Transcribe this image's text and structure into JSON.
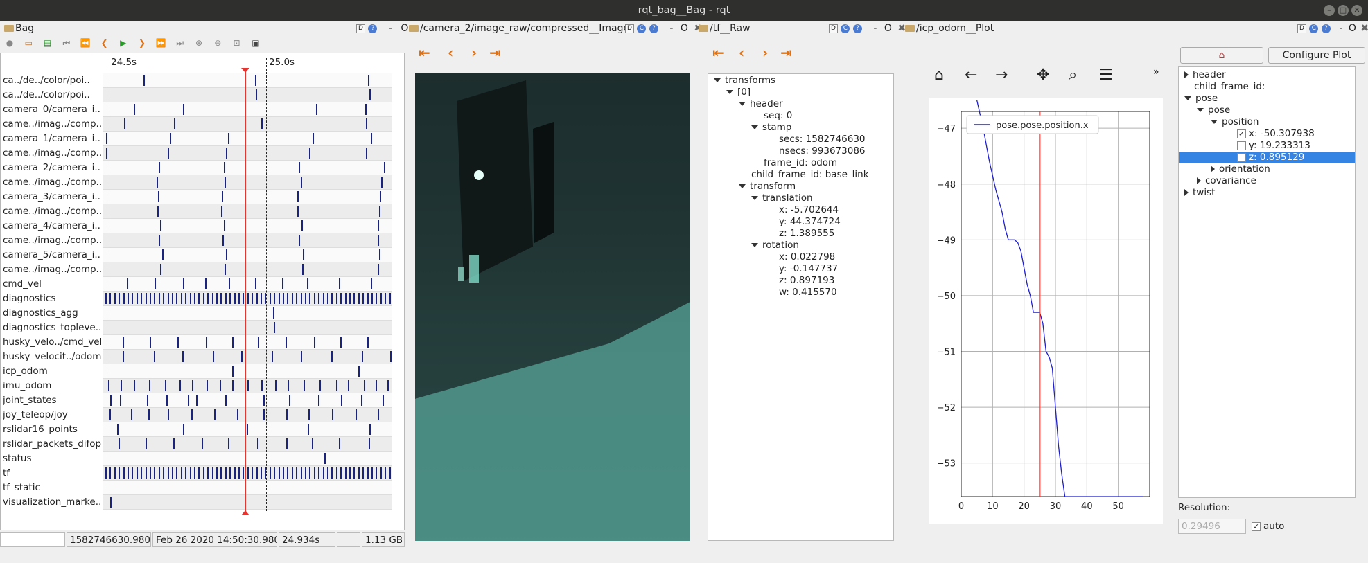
{
  "window": {
    "title": "rqt_bag__Bag - rqt"
  },
  "docks": {
    "bag": {
      "title": "Bag",
      "btns": [
        "D",
        "?",
        "-",
        "O"
      ]
    },
    "image": {
      "title": "/camera_2/image_raw/compressed__Image",
      "btns": [
        "D",
        "C",
        "?",
        "-",
        "O",
        "✖"
      ]
    },
    "tf": {
      "title": "/tf__Raw",
      "btns": [
        "D",
        "C",
        "?",
        "-",
        "O",
        "✖"
      ]
    },
    "plot": {
      "title": "/icp_odom__Plot",
      "btns": [
        "D",
        "C",
        "?",
        "-",
        "O",
        "✖"
      ]
    }
  },
  "bag": {
    "time_ticks": [
      "24.5s",
      "25.0s"
    ],
    "topics": [
      "ca../de../color/poi..",
      "ca../de../color/poi..",
      "camera_0/camera_i..",
      "came../imag../comp..",
      "camera_1/camera_i..",
      "came../imag../comp..",
      "camera_2/camera_i..",
      "came../imag../comp..",
      "camera_3/camera_i..",
      "came../imag../comp..",
      "camera_4/camera_i..",
      "came../imag../comp..",
      "camera_5/camera_i..",
      "came../imag../comp..",
      "cmd_vel",
      "diagnostics",
      "diagnostics_agg",
      "diagnostics_topleve..",
      "husky_velo../cmd_vel",
      "husky_velocit../odom",
      "icp_odom",
      "imu_odom",
      "joint_states",
      "joy_teleop/joy",
      "rslidar16_points",
      "rslidar_packets_difop",
      "status",
      "tf",
      "tf_static",
      "visualization_marke.."
    ],
    "status": {
      "field0": "",
      "stamp": "1582746630.980",
      "date": "Feb 26 2020 14:50:30.980",
      "offset": "24.934s",
      "blank": "",
      "size": "1.13 GB"
    }
  },
  "tf_tree": {
    "transforms": "transforms",
    "index": "[0]",
    "header": "header",
    "seq": "seq:  0",
    "stamp": "stamp",
    "secs": "secs:  1582746630",
    "nsecs": "nsecs:  993673086",
    "frame_id": "frame_id: odom",
    "child_frame_id": "child_frame_id: base_link",
    "transform": "transform",
    "translation": "translation",
    "tx": "x:  -5.702644",
    "ty": "y:  44.374724",
    "tz": "z:  1.389555",
    "rotation": "rotation",
    "rx": "x:  0.022798",
    "ry": "y:  -0.147737",
    "rz": "z:  0.897193",
    "rw": "w:  0.415570"
  },
  "plot": {
    "configure": "Configure Plot",
    "more": "»",
    "resolution_label": "Resolution:",
    "resolution_value": "0.29496",
    "auto_label": "auto",
    "tree": {
      "header": "header",
      "child_frame_id": "child_frame_id:",
      "pose": "pose",
      "pose2": "pose",
      "position": "position",
      "px": "x:  -50.307938",
      "py": "y:  19.233313",
      "pz": "z:  0.895129",
      "orientation": "orientation",
      "covariance": "covariance",
      "twist": "twist"
    }
  },
  "chart_data": {
    "type": "line",
    "series": [
      {
        "name": "pose.pose.position.x",
        "x": [
          5,
          7,
          9,
          11,
          13,
          14,
          15,
          16,
          17,
          18,
          19,
          20,
          21,
          22,
          23,
          24,
          25,
          26,
          27,
          28,
          29,
          30,
          31,
          32,
          33,
          34,
          35,
          40,
          45,
          50,
          55,
          58
        ],
        "y": [
          -46.5,
          -47.0,
          -47.6,
          -48.1,
          -48.5,
          -48.8,
          -49.0,
          -49.0,
          -49.0,
          -49.05,
          -49.2,
          -49.5,
          -49.8,
          -50.0,
          -50.3,
          -50.3,
          -50.3,
          -50.5,
          -51.0,
          -51.1,
          -51.3,
          -52.0,
          -52.7,
          -53.2,
          -53.6,
          -53.6,
          -53.6,
          -53.6,
          -53.6,
          -53.6,
          -53.6,
          -53.6
        ]
      }
    ],
    "xlim": [
      0,
      60
    ],
    "ylim": [
      -53.6,
      -46.7
    ],
    "xticks": [
      0,
      10,
      20,
      30,
      40,
      50
    ],
    "yticks": [
      -47,
      -48,
      -49,
      -50,
      -51,
      -52,
      -53
    ],
    "marker_x": 25,
    "grid": true,
    "legend": "top-left",
    "line_color": "#1f1fcc",
    "marker_color": "#e8332f"
  }
}
